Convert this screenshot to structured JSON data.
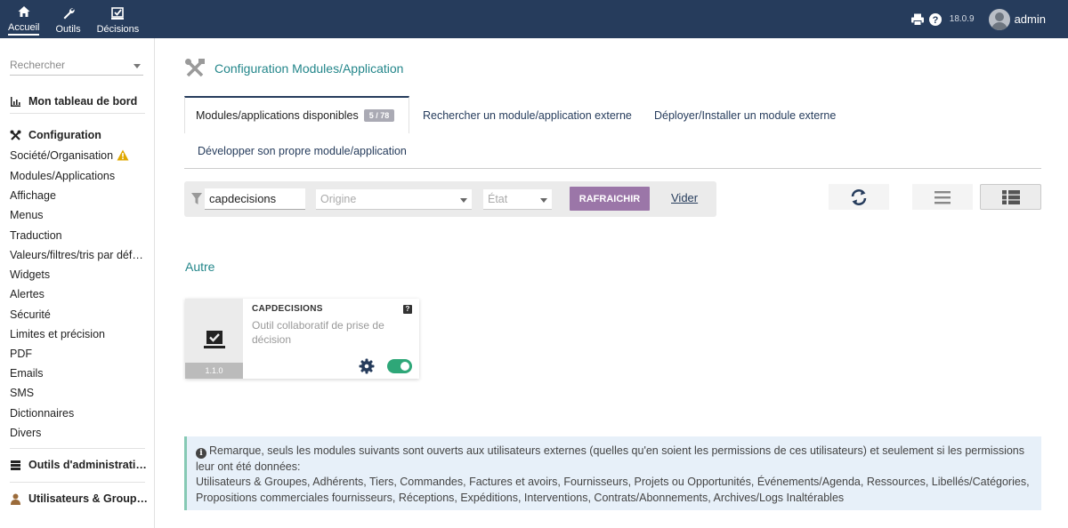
{
  "topbar": {
    "nav": [
      {
        "label": "Accueil",
        "icon": "home-icon"
      },
      {
        "label": "Outils",
        "icon": "wrench-icon"
      },
      {
        "label": "Décisions",
        "icon": "check-box-icon"
      }
    ],
    "version": "18.0.9",
    "user": "admin",
    "background": "#263c5c"
  },
  "sidebar": {
    "search_placeholder": "Rechercher",
    "dashboard": "Mon tableau de bord",
    "config_heading": "Configuration",
    "items": [
      "Société/Organisation",
      "Modules/Applications",
      "Affichage",
      "Menus",
      "Traduction",
      "Valeurs/filtres/tris par déf…",
      "Widgets",
      "Alertes",
      "Sécurité",
      "Limites et précision",
      "PDF",
      "Emails",
      "SMS",
      "Dictionnaires",
      "Divers"
    ],
    "admin_tools": "Outils d'administrati…",
    "users_groups": "Utilisateurs & Group…"
  },
  "main": {
    "title": "Configuration Modules/Application",
    "tabs": {
      "available": "Modules/applications disponibles",
      "available_badge": "5 / 78",
      "search_external": "Rechercher un module/application externe",
      "deploy": "Déployer/Installer un module externe",
      "develop": "Développer son propre module/application"
    },
    "filter": {
      "keyword": "capdecisions",
      "origin_placeholder": "Origine",
      "state_placeholder": "État",
      "refresh_label": "RAFRAICHIR",
      "clear_label": "Vider"
    },
    "group": "Autre",
    "module": {
      "name": "CAPDECISIONS",
      "help": "?",
      "description": "Outil collaboratif de prise de décision",
      "version": "1.1.0",
      "enabled": true
    },
    "notice": {
      "line1": "Remarque, seuls les modules suivants sont ouverts aux utilisateurs externes (quelles qu'en soient les permissions de ces utilisateurs) et seulement si les permissions leur ont été données:",
      "line2": "Utilisateurs & Groupes, Adhérents, Tiers, Commandes, Factures et avoirs, Fournisseurs, Projets ou Opportunités, Événements/Agenda, Ressources, Libellés/Catégories, Propositions commerciales fournisseurs, Réceptions, Expéditions, Interventions, Contrats/Abonnements, Archives/Logs Inaltérables"
    }
  },
  "colors": {
    "accent_teal": "#23868a",
    "button_purple": "#9b76a8",
    "toggle_green": "#2ea778",
    "warning": "#e0a800"
  }
}
